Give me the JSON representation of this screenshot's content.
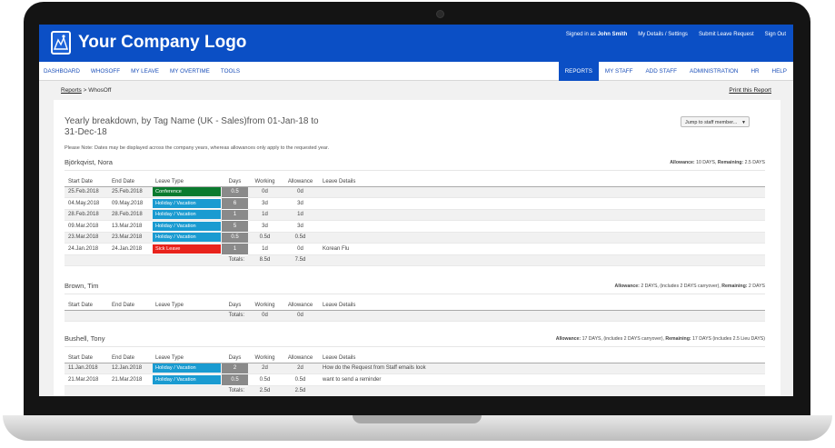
{
  "header": {
    "logo_text": "Your Company Logo",
    "signed_in_prefix": "Signed in as",
    "user_name": "John Smith",
    "links": [
      "My Details / Settings",
      "Submit Leave Request",
      "Sign Out"
    ]
  },
  "nav": {
    "left": [
      "DASHBOARD",
      "WHOSOFF",
      "MY LEAVE",
      "MY OVERTIME",
      "TOOLS"
    ],
    "right": [
      "REPORTS",
      "MY STAFF",
      "ADD STAFF",
      "ADMINISTRATION",
      "HR",
      "HELP"
    ],
    "active": "REPORTS"
  },
  "breadcrumb": {
    "link": "Reports",
    "separator": " > ",
    "current": "WhosOff"
  },
  "print_label": "Print this Report",
  "report": {
    "title": "Yearly breakdown, by Tag Name (UK - Sales)from 01-Jan-18 to 31-Dec-18",
    "jump_label": "Jump to staff member...",
    "note": "Please Note: Dates may be displayed across the company years, whereas allowances only apply to the requested year."
  },
  "columns": [
    "Start Date",
    "End Date",
    "Leave Type",
    "Days",
    "Working",
    "Allowance",
    "Leave Details"
  ],
  "totals_label": "Totals:",
  "colors": {
    "brand": "#0b4fc5",
    "conference": "#0a7a2e",
    "holiday": "#1a9bd1",
    "sick": "#e8231c",
    "days_cell": "#8a8a8a"
  },
  "employees": [
    {
      "name": "Björkqvist, Nora",
      "allowance_label": "Allowance:",
      "allowance_value": "10 DAYS, ",
      "remaining_label": "Remaining:",
      "remaining_value": "2.5 DAYS",
      "rows": [
        {
          "start": "25.Feb.2018",
          "end": "25.Feb.2018",
          "type": "Conference",
          "kind": "conference",
          "days": "0.5",
          "working": "0d",
          "allowance": "0d",
          "details": ""
        },
        {
          "start": "04.May.2018",
          "end": "09.May.2018",
          "type": "Holiday / Vacation",
          "kind": "holiday",
          "days": "6",
          "working": "3d",
          "allowance": "3d",
          "details": ""
        },
        {
          "start": "28.Feb.2018",
          "end": "28.Feb.2018",
          "type": "Holiday / Vacation",
          "kind": "holiday",
          "days": "1",
          "working": "1d",
          "allowance": "1d",
          "details": ""
        },
        {
          "start": "09.Mar.2018",
          "end": "13.Mar.2018",
          "type": "Holiday / Vacation",
          "kind": "holiday",
          "days": "5",
          "working": "3d",
          "allowance": "3d",
          "details": ""
        },
        {
          "start": "23.Mar.2018",
          "end": "23.Mar.2018",
          "type": "Holiday / Vacation",
          "kind": "holiday",
          "days": "0.5",
          "working": "0.5d",
          "allowance": "0.5d",
          "details": ""
        },
        {
          "start": "24.Jan.2018",
          "end": "24.Jan.2018",
          "type": "Sick Leave",
          "kind": "sick",
          "days": "1",
          "working": "1d",
          "allowance": "0d",
          "details": "Korean Flu"
        }
      ],
      "totals": {
        "working": "8.5d",
        "allowance": "7.5d"
      }
    },
    {
      "name": "Brown, Tim",
      "allowance_label": "Allowance:",
      "allowance_value": "2 DAYS, (includes 2 DAYS carryover), ",
      "remaining_label": "Remaining:",
      "remaining_value": "2 DAYS",
      "rows": [],
      "totals": {
        "working": "0d",
        "allowance": "0d"
      }
    },
    {
      "name": "Bushell, Tony",
      "allowance_label": "Allowance:",
      "allowance_value": "17 DAYS, (includes 2 DAYS carryover), ",
      "remaining_label": "Remaining:",
      "remaining_value": "17 DAYS (includes 2.5 Lieu DAYS)",
      "rows": [
        {
          "start": "11.Jan.2018",
          "end": "12.Jan.2018",
          "type": "Holiday / Vacation",
          "kind": "holiday",
          "days": "2",
          "working": "2d",
          "allowance": "2d",
          "details": "How do the Request from Staff emails look"
        },
        {
          "start": "21.Mar.2018",
          "end": "21.Mar.2018",
          "type": "Holiday / Vacation",
          "kind": "holiday",
          "days": "0.5",
          "working": "0.5d",
          "allowance": "0.5d",
          "details": "want to send a reminder"
        }
      ],
      "totals": {
        "working": "2.5d",
        "allowance": "2.5d"
      }
    }
  ]
}
